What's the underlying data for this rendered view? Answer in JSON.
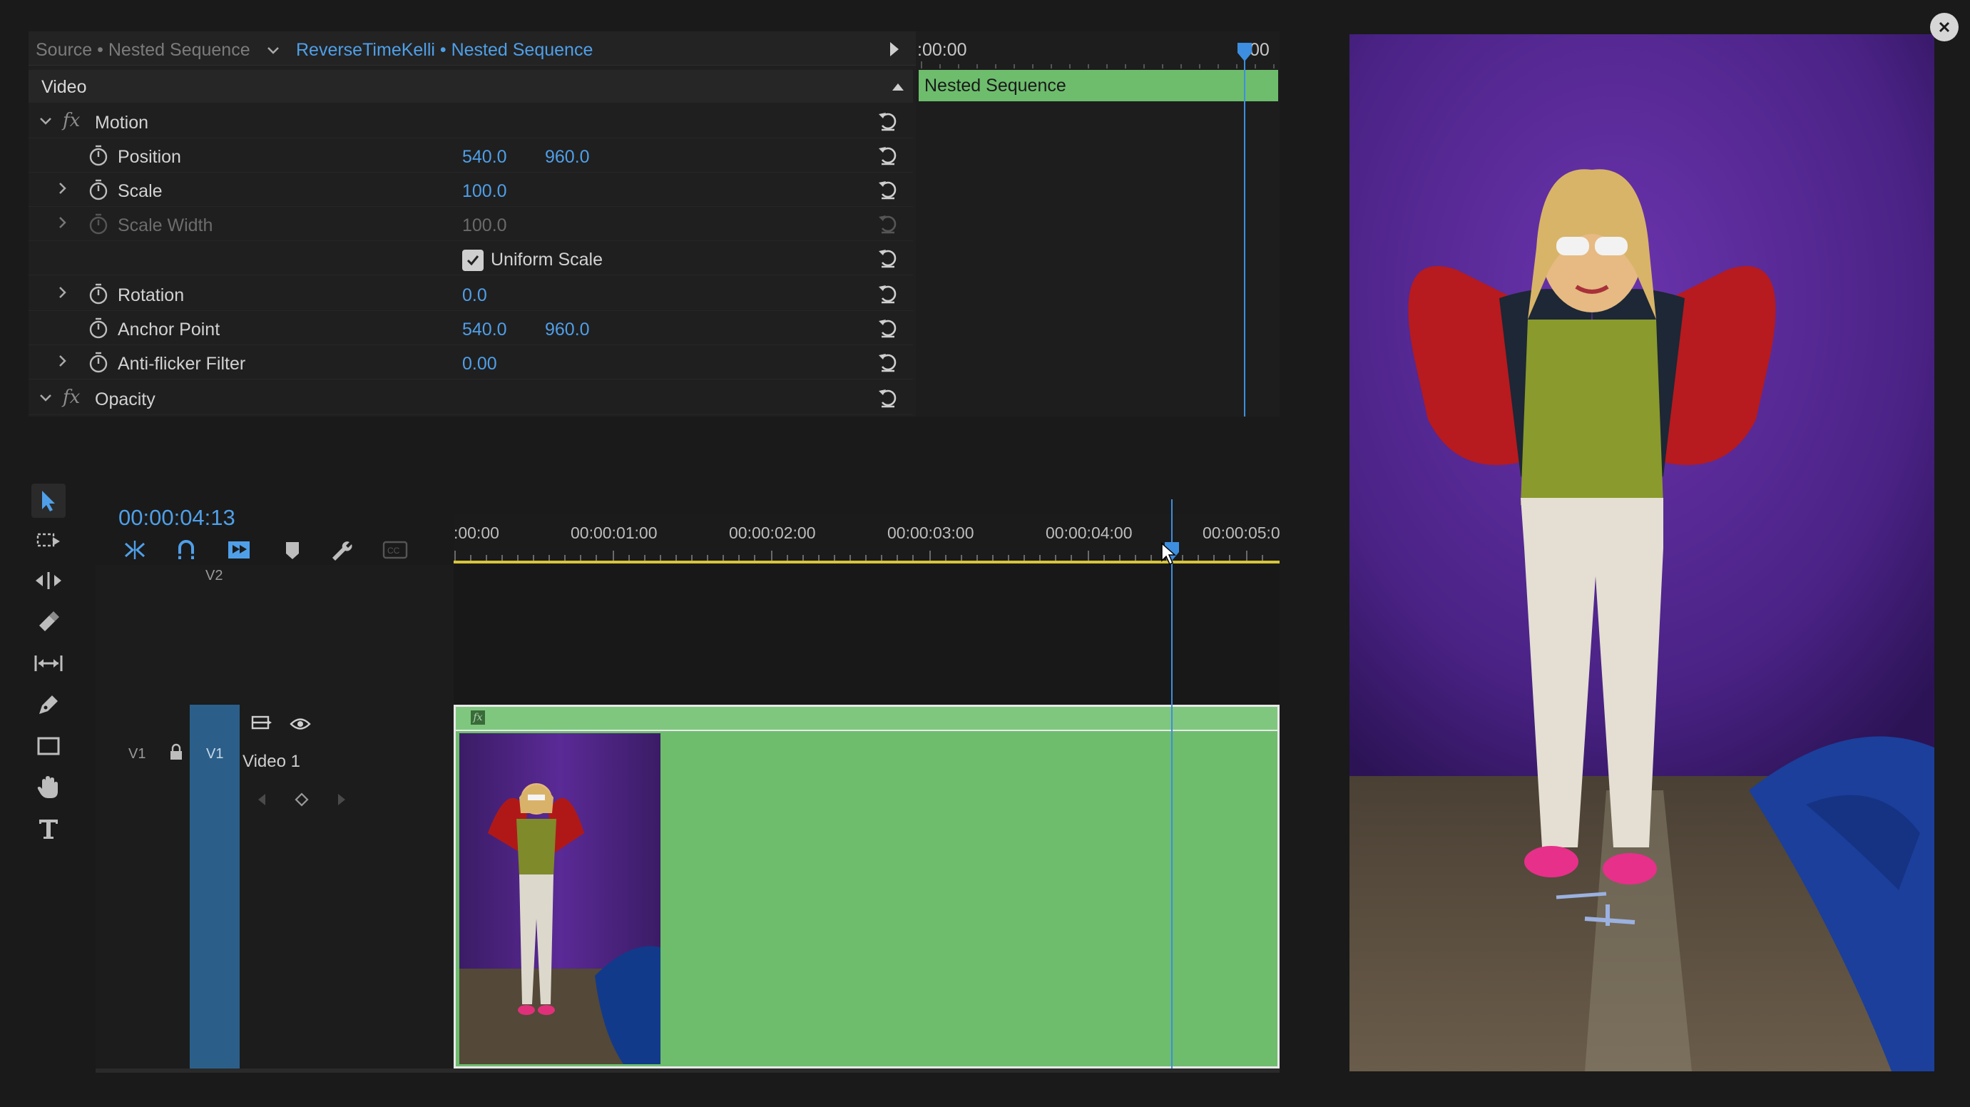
{
  "effect_controls": {
    "source_label": "Source • Nested Sequence",
    "sequence_title": "ReverseTimeKelli • Nested Sequence",
    "section_label": "Video",
    "fx_symbol": "fx",
    "motion": {
      "label": "Motion",
      "position": {
        "label": "Position",
        "x": "540.0",
        "y": "960.0"
      },
      "scale": {
        "label": "Scale",
        "value": "100.0"
      },
      "scale_width": {
        "label": "Scale Width",
        "value": "100.0"
      },
      "uniform_scale": {
        "label": "Uniform Scale",
        "checked": true
      },
      "rotation": {
        "label": "Rotation",
        "value": "0.0"
      },
      "anchor_point": {
        "label": "Anchor Point",
        "x": "540.0",
        "y": "960.0"
      },
      "anti_flicker": {
        "label": "Anti-flicker Filter",
        "value": "0.00"
      }
    },
    "opacity": {
      "label": "Opacity"
    }
  },
  "mini_timeline": {
    "time_start": ":00:00",
    "time_end": "00",
    "clip_label": "Nested Sequence"
  },
  "timeline": {
    "timecode": "00:00:04:13",
    "ruler_labels": [
      ":00:00",
      "00:00:01:00",
      "00:00:02:00",
      "00:00:03:00",
      "00:00:04:00",
      "00:00:05:0"
    ],
    "tracks": {
      "v2_label": "V2",
      "v1_label": "V1",
      "v1_target_label": "V1",
      "v1_name": "Video 1"
    },
    "clip_badge": "fx"
  },
  "icons": {
    "tools": [
      "selection-tool-icon",
      "track-select-icon",
      "ripple-edit-icon",
      "razor-icon",
      "slip-icon",
      "pen-icon",
      "rectangle-icon",
      "hand-icon",
      "type-icon"
    ],
    "timeline_toolbar": [
      "snap-icon",
      "linked-selection-icon",
      "add-marker-icon",
      "marker-icon",
      "wrench-icon",
      "captions-icon"
    ]
  },
  "colors": {
    "accent": "#4f9fe8",
    "clip_green": "#6dbd6d",
    "work_area": "#d8c53a",
    "playhead": "#3d8ee0"
  }
}
